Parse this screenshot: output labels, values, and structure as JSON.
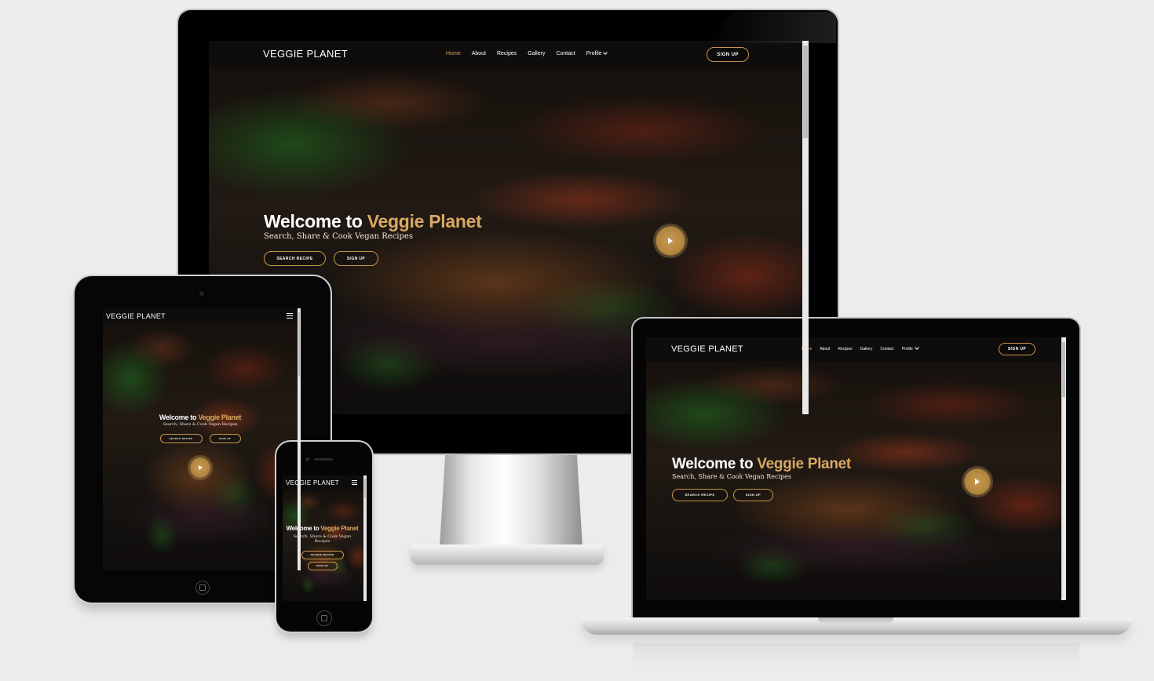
{
  "site": {
    "brand": "VEGGIE PLANET",
    "nav": {
      "home": "Home",
      "about": "About",
      "recipes": "Recipes",
      "gallery": "Gallery",
      "contact": "Contact",
      "profile": "Profile"
    },
    "nav_signup": "SIGN UP",
    "hero": {
      "title_prefix": "Welcome to",
      "title_highlight": "Veggie Planet",
      "subtitle": "Search, Share & Cook Vegan Recipes",
      "search_button": "SEARCH RECIPE",
      "signup_button": "SIGN UP"
    },
    "icons": {
      "play": "play-icon",
      "menu": "hamburger-menu-icon",
      "dropdown": "chevron-down-icon"
    },
    "colors": {
      "accent_gold": "#d9a862",
      "nav_background": "#0f0d0b",
      "text": "#ffffff"
    }
  }
}
